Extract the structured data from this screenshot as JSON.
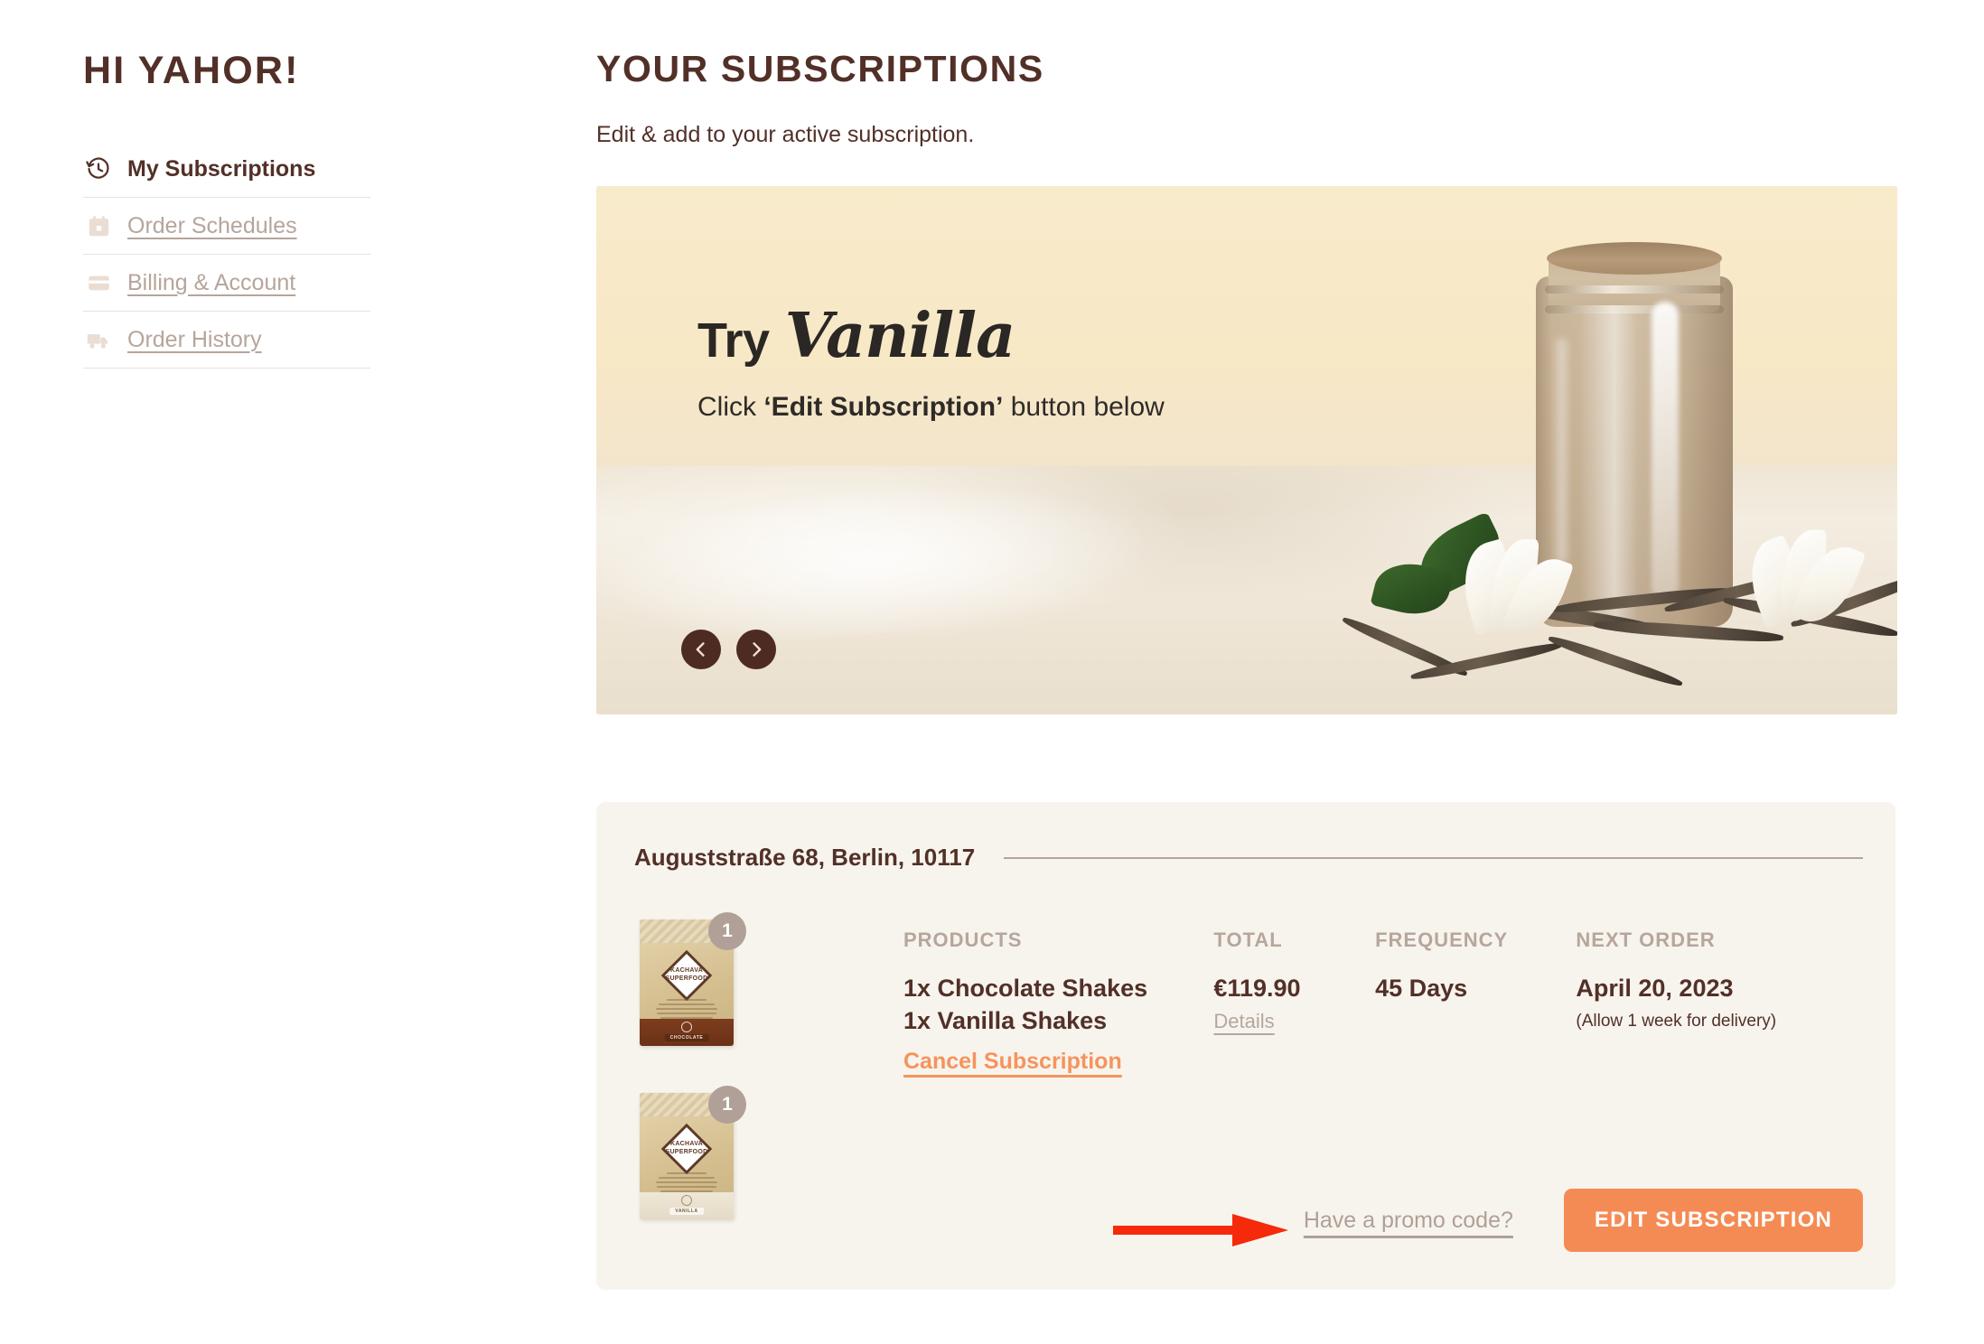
{
  "sidebar": {
    "greeting": "HI YAHOR!",
    "items": [
      {
        "label": "My Subscriptions",
        "icon": "history-clock-icon",
        "active": true
      },
      {
        "label": "Order Schedules",
        "icon": "calendar-icon",
        "active": false
      },
      {
        "label": "Billing & Account",
        "icon": "credit-card-icon",
        "active": false
      },
      {
        "label": "Order History",
        "icon": "truck-icon",
        "active": false
      }
    ]
  },
  "main": {
    "title": "YOUR SUBSCRIPTIONS",
    "subtitle": "Edit & add to your active subscription."
  },
  "banner": {
    "try_word": "Try",
    "flavor": "Vanilla",
    "cta_prefix": "Click ",
    "cta_bold": "‘Edit Subscription’",
    "cta_suffix": " button below",
    "prev_label": "Previous slide",
    "next_label": "Next slide"
  },
  "subscription": {
    "address": "Auguststraße 68, Berlin, 10117",
    "thumbnails": [
      {
        "flavor": "CHOCOLATE",
        "brand": "KACHAVA",
        "brand_sub": "SUPERFOOD",
        "tagline": "THE WHOLE BODY MEAL",
        "quantity": "1"
      },
      {
        "flavor": "VANILLA",
        "brand": "KACHAVA",
        "brand_sub": "SUPERFOOD",
        "tagline": "THE WHOLE BODY MEAL",
        "quantity": "1"
      }
    ],
    "columns": {
      "products_head": "PRODUCTS",
      "products": [
        "1x Chocolate Shakes",
        "1x Vanilla Shakes"
      ],
      "cancel_label": "Cancel Subscription",
      "total_head": "TOTAL",
      "total_value": "€119.90",
      "details_label": "Details",
      "frequency_head": "FREQUENCY",
      "frequency_value": "45 Days",
      "next_order_head": "NEXT ORDER",
      "next_order_value": "April 20, 2023",
      "next_order_note": "(Allow 1 week for delivery)"
    },
    "promo_label": "Have a promo code?",
    "edit_label": "EDIT SUBSCRIPTION"
  },
  "colors": {
    "brand_brown": "#523028",
    "muted_taupe": "#b6a69c",
    "accent_orange": "#f58b54",
    "cancel_orange": "#f5945d",
    "card_bg": "#f7f4ed",
    "annotation_red": "#f42a0a"
  }
}
